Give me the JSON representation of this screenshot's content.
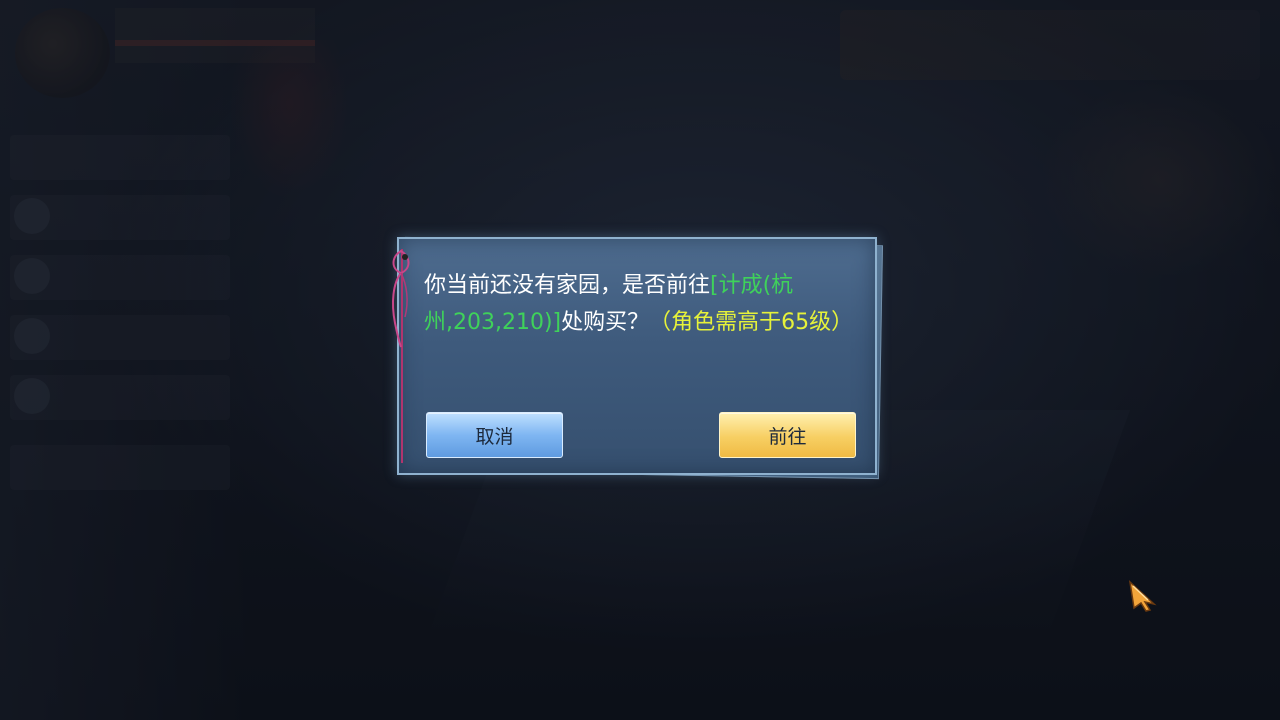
{
  "dialog": {
    "message_prefix": "你当前还没有家园，是否前往",
    "location_link": "[计成(杭州,203,210)]",
    "message_middle": "处购买？",
    "requirement": "（角色需高于65级）",
    "cancel_label": "取消",
    "go_label": "前往"
  },
  "colors": {
    "link_green": "#3fd25a",
    "requirement_yellow": "#e6f23a",
    "cancel_button": "#7fb6f2",
    "go_button": "#f7cf63",
    "dialog_bg": "#3e5a7c"
  },
  "icons": {
    "cursor": "arrow-cursor-icon",
    "ribbon": "ribbon-icon"
  }
}
